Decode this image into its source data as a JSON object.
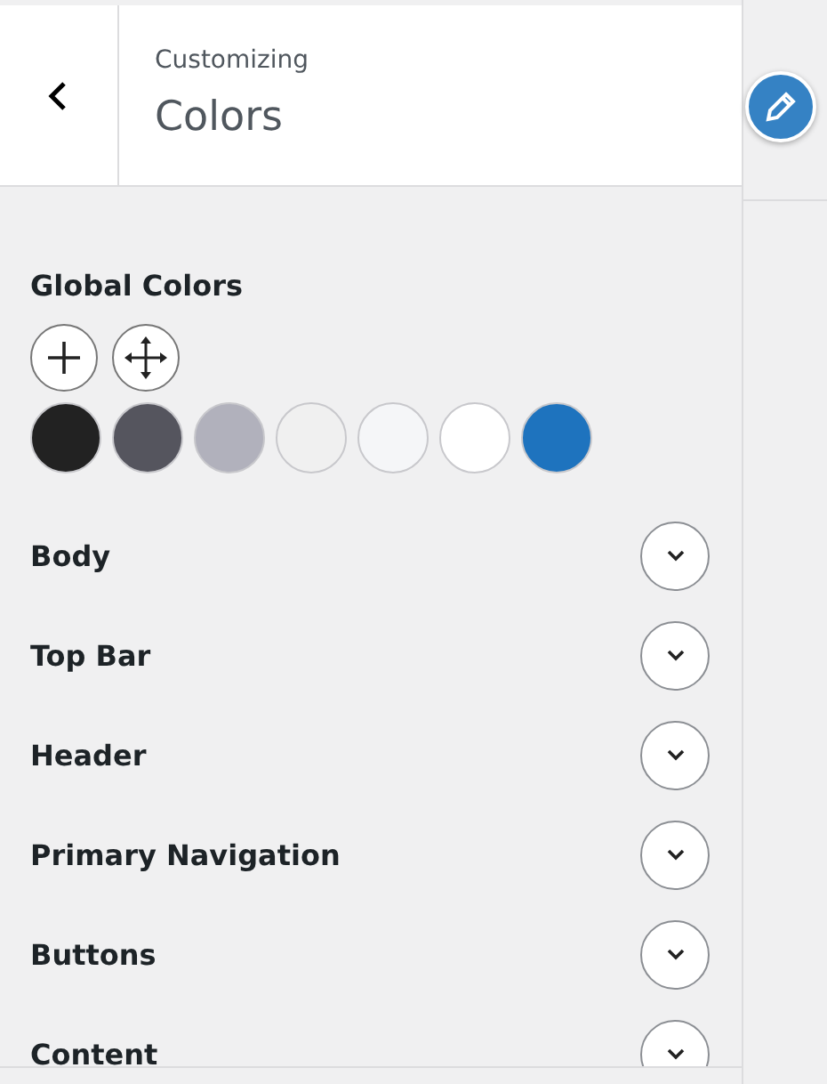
{
  "header": {
    "subtitle": "Customizing",
    "title": "Colors"
  },
  "global_colors": {
    "heading": "Global Colors",
    "swatches": [
      {
        "color": "#222222"
      },
      {
        "color": "#55555e"
      },
      {
        "color": "#b1b1bc"
      },
      {
        "color": "#f0f0f0"
      },
      {
        "color": "#f5f6f8"
      },
      {
        "color": "#ffffff"
      },
      {
        "color": "#1e73be"
      }
    ]
  },
  "sections": [
    {
      "label": "Body",
      "expanded": false
    },
    {
      "label": "Top Bar",
      "expanded": false
    },
    {
      "label": "Header",
      "expanded": false
    },
    {
      "label": "Primary Navigation",
      "expanded": false
    },
    {
      "label": "Buttons",
      "expanded": false
    },
    {
      "label": "Content",
      "expanded": false
    }
  ]
}
